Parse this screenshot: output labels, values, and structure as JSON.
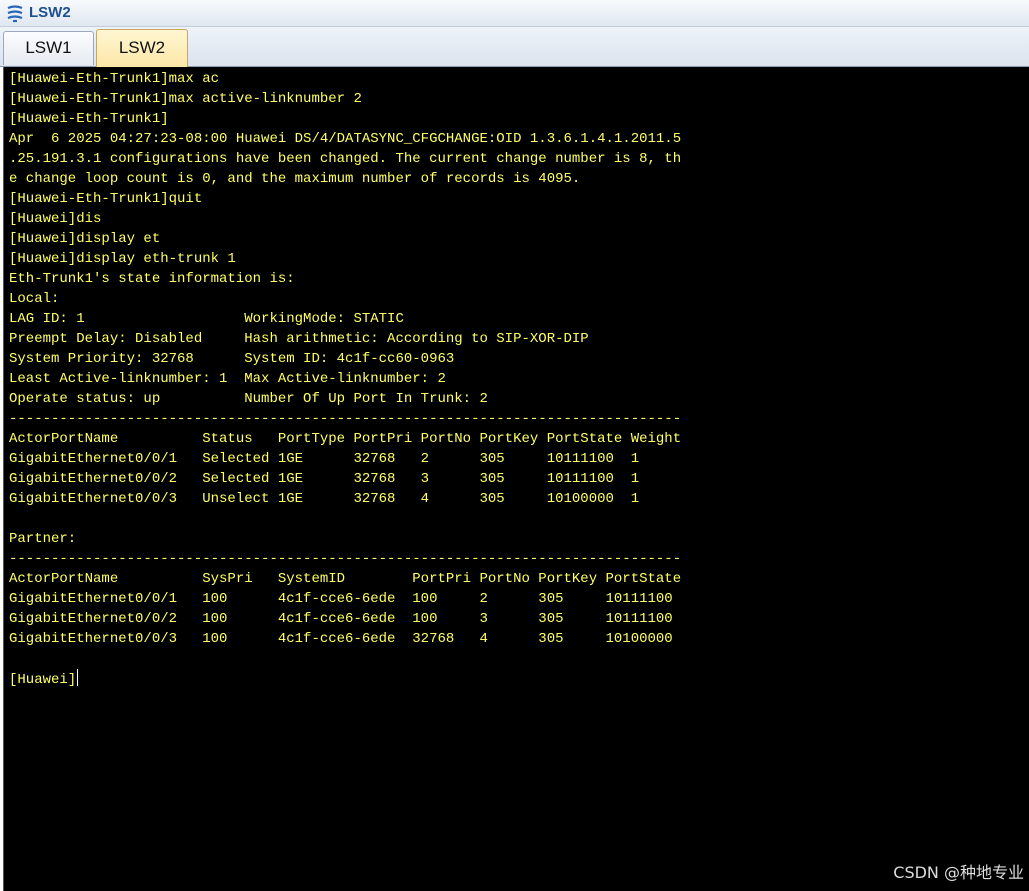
{
  "window": {
    "title": "LSW2",
    "icon": "network-device-icon"
  },
  "tabs": [
    {
      "label": "LSW1",
      "active": false
    },
    {
      "label": "LSW2",
      "active": true
    }
  ],
  "terminal": {
    "text_color": "#ffff66",
    "background": "#000000",
    "lines": [
      "[Huawei-Eth-Trunk1]max ac",
      "[Huawei-Eth-Trunk1]max active-linknumber 2",
      "[Huawei-Eth-Trunk1]",
      "Apr  6 2025 04:27:23-08:00 Huawei DS/4/DATASYNC_CFGCHANGE:OID 1.3.6.1.4.1.2011.5",
      ".25.191.3.1 configurations have been changed. The current change number is 8, th",
      "e change loop count is 0, and the maximum number of records is 4095.",
      "[Huawei-Eth-Trunk1]quit",
      "[Huawei]dis",
      "[Huawei]display et",
      "[Huawei]display eth-trunk 1",
      "Eth-Trunk1's state information is:",
      "Local:",
      "LAG ID: 1                   WorkingMode: STATIC",
      "Preempt Delay: Disabled     Hash arithmetic: According to SIP-XOR-DIP",
      "System Priority: 32768      System ID: 4c1f-cc60-0963",
      "Least Active-linknumber: 1  Max Active-linknumber: 2",
      "Operate status: up          Number Of Up Port In Trunk: 2",
      "--------------------------------------------------------------------------------",
      "ActorPortName          Status   PortType PortPri PortNo PortKey PortState Weight",
      "GigabitEthernet0/0/1   Selected 1GE      32768   2      305     10111100  1",
      "GigabitEthernet0/0/2   Selected 1GE      32768   3      305     10111100  1",
      "GigabitEthernet0/0/3   Unselect 1GE      32768   4      305     10100000  1",
      "",
      "Partner:",
      "--------------------------------------------------------------------------------",
      "ActorPortName          SysPri   SystemID        PortPri PortNo PortKey PortState",
      "GigabitEthernet0/0/1   100      4c1f-cce6-6ede  100     2      305     10111100",
      "GigabitEthernet0/0/2   100      4c1f-cce6-6ede  100     3      305     10111100",
      "GigabitEthernet0/0/3   100      4c1f-cce6-6ede  32768   4      305     10100000",
      "",
      "[Huawei]"
    ]
  },
  "watermark": "CSDN @种地专业"
}
